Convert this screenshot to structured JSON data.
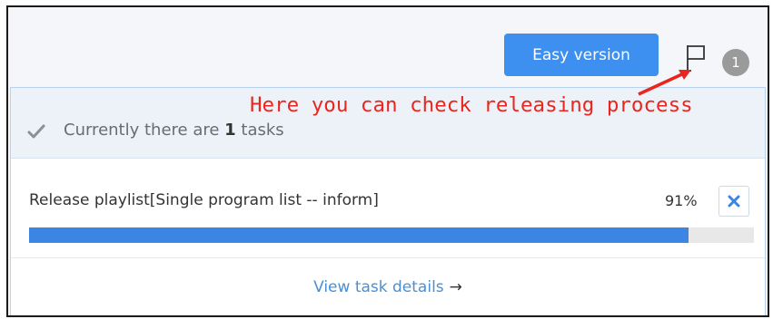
{
  "topbar": {
    "easy_version_label": "Easy version",
    "notification_count": "1"
  },
  "annotation": {
    "text": "Here you can check releasing process",
    "color": "#e8261f"
  },
  "panel": {
    "header_prefix": "Currently there are ",
    "header_count": "1",
    "header_suffix": " tasks",
    "task": {
      "name": "Release playlist[Single program list -- inform]",
      "percent_label": "91%",
      "progress": 0.91
    },
    "view_details_label": "View task details",
    "view_details_arrow": "→"
  },
  "colors": {
    "accent": "#3d8ff0",
    "progress_fill": "#3b86e3",
    "link": "#4a8fd6"
  }
}
